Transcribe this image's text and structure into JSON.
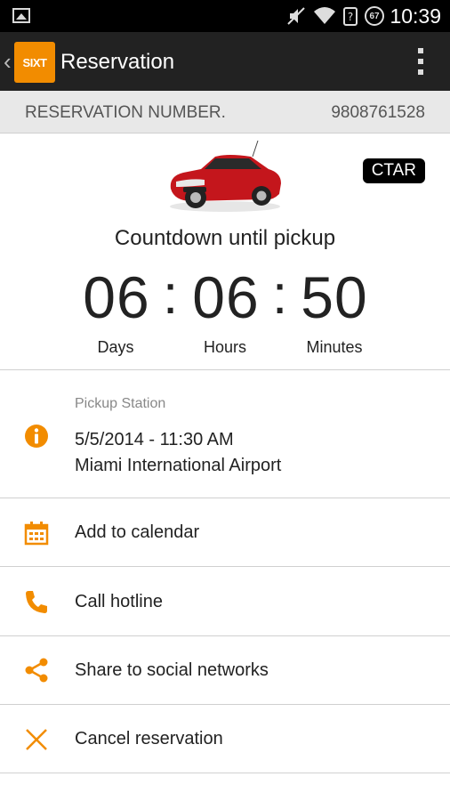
{
  "status_bar": {
    "time": "10:39",
    "battery": "67",
    "icons": [
      "gallery-icon",
      "mute-icon",
      "wifi-icon",
      "no-sim-icon",
      "battery-icon"
    ]
  },
  "action_bar": {
    "logo_text": "SIXT",
    "title": "Reservation",
    "menu_icon": "overflow-menu-icon"
  },
  "reservation": {
    "label": "RESERVATION NUMBER.",
    "number": "9808761528"
  },
  "vehicle": {
    "code": "CTAR",
    "image": "red convertible car"
  },
  "countdown": {
    "title": "Countdown until pickup",
    "days": "06",
    "hours": "06",
    "minutes": "50",
    "separator": ":",
    "labels": {
      "days": "Days",
      "hours": "Hours",
      "minutes": "Minutes"
    }
  },
  "pickup": {
    "caption": "Pickup Station",
    "datetime": "5/5/2014 - 11:30 AM",
    "location": "Miami International Airport",
    "icon": "info-icon"
  },
  "actions": [
    {
      "label": "Add to calendar",
      "icon": "calendar-icon"
    },
    {
      "label": "Call hotline",
      "icon": "phone-icon"
    },
    {
      "label": "Share to social networks",
      "icon": "share-icon"
    },
    {
      "label": "Cancel reservation",
      "icon": "close-icon"
    }
  ],
  "colors": {
    "accent": "#f28c00",
    "action_bar": "#222222",
    "status_bar": "#000000",
    "reservation_bar": "#e8e8e8"
  }
}
